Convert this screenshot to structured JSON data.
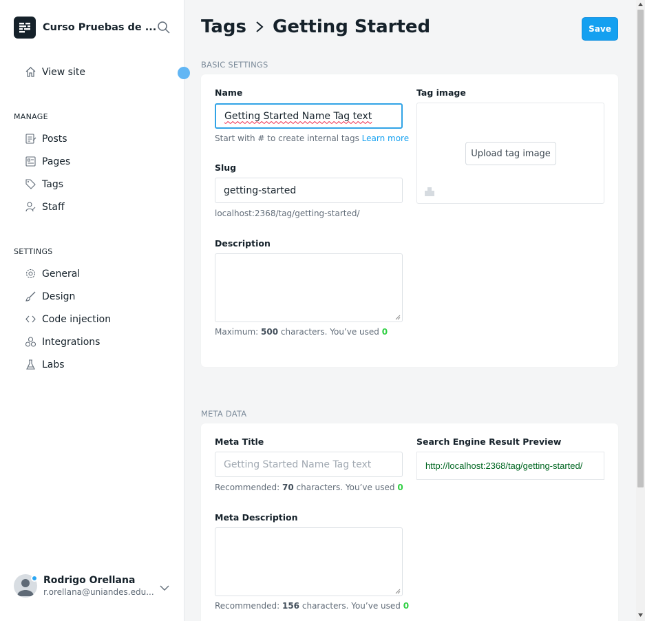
{
  "sidebar": {
    "site_title": "Curso Pruebas de ...",
    "view_site": "View site",
    "manage_heading": "MANAGE",
    "manage_items": [
      {
        "label": "Posts",
        "icon": "posts-icon"
      },
      {
        "label": "Pages",
        "icon": "pages-icon"
      },
      {
        "label": "Tags",
        "icon": "tag-icon"
      },
      {
        "label": "Staff",
        "icon": "staff-icon"
      }
    ],
    "settings_heading": "SETTINGS",
    "settings_items": [
      {
        "label": "General",
        "icon": "gear-icon"
      },
      {
        "label": "Design",
        "icon": "brush-icon"
      },
      {
        "label": "Code injection",
        "icon": "code-icon"
      },
      {
        "label": "Integrations",
        "icon": "integrations-icon"
      },
      {
        "label": "Labs",
        "icon": "flask-icon"
      }
    ],
    "user": {
      "name": "Rodrigo Orellana",
      "email": "r.orellana@uniandes.edu..."
    }
  },
  "header": {
    "breadcrumb_parent": "Tags",
    "breadcrumb_current": "Getting Started",
    "save_label": "Save"
  },
  "basic_settings": {
    "section_title": "BASIC SETTINGS",
    "name_label": "Name",
    "name_value": "Getting Started Name Tag text",
    "name_hint": "Start with # to create internal tags",
    "name_hint_link": "Learn more",
    "slug_label": "Slug",
    "slug_value": "getting-started",
    "slug_url": "localhost:2368/tag/getting-started/",
    "description_label": "Description",
    "description_value": "",
    "description_hint_prefix": "Maximum:",
    "description_max": "500",
    "description_hint_middle": "characters. You’ve used",
    "description_used": "0",
    "tag_image_label": "Tag image",
    "upload_label": "Upload tag image"
  },
  "meta_data": {
    "section_title": "META DATA",
    "meta_title_label": "Meta Title",
    "meta_title_placeholder": "Getting Started Name Tag text",
    "meta_title_hint_prefix": "Recommended:",
    "meta_title_recommended": "70",
    "meta_title_hint_middle": "characters. You’ve used",
    "meta_title_used": "0",
    "serp_label": "Search Engine Result Preview",
    "serp_url": "http://localhost:2368/tag/getting-started/",
    "meta_description_label": "Meta Description",
    "meta_description_hint_prefix": "Recommended:",
    "meta_description_recommended": "156",
    "meta_description_hint_middle": "characters. You’ve used",
    "meta_description_used": "0"
  },
  "colors": {
    "accent": "#14a0f0",
    "success": "#30cf43",
    "sidebar_bg": "#ffffff",
    "page_bg": "#f4f5f6"
  }
}
